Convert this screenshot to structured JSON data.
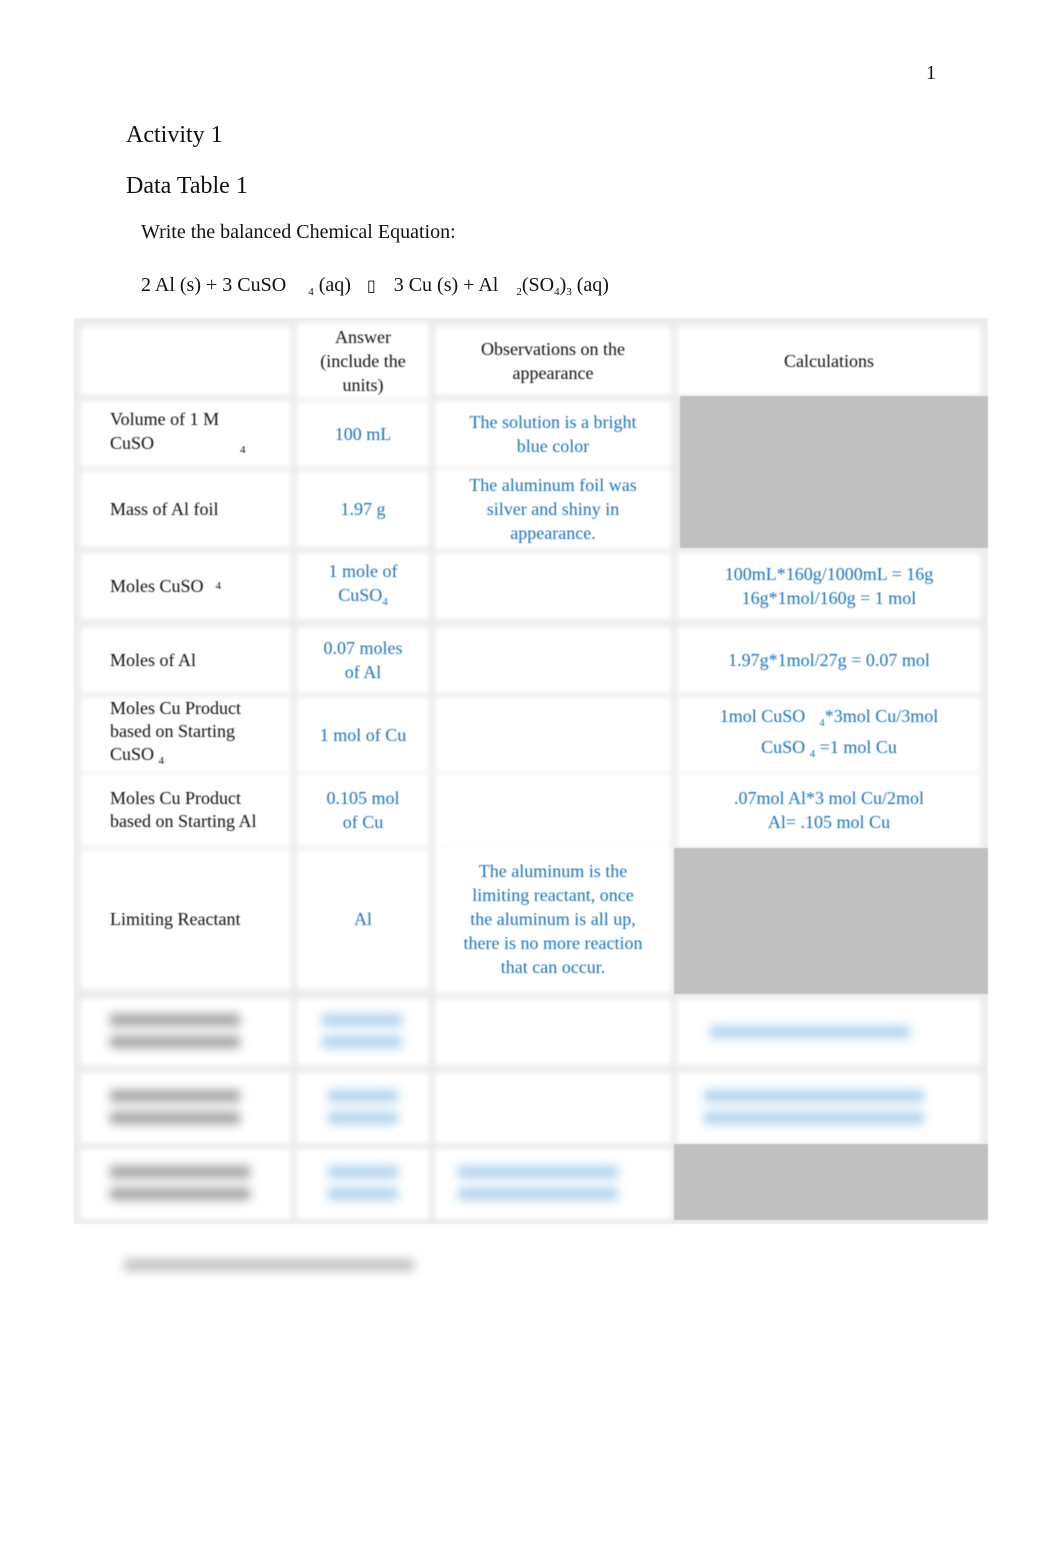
{
  "page_number": "1",
  "activity_title": "Activity 1",
  "table_title": "Data Table 1",
  "prompt": "Write the balanced Chemical Equation:",
  "equation": {
    "lhs_part1": "2 Al (s) + 3 CuSO",
    "lhs_sub": "4",
    "lhs_part2": " (aq)",
    "arrow": "▯",
    "rhs_part1": "3 Cu (s) + Al",
    "rhs_sub1": "2",
    "rhs_part2": "(SO",
    "rhs_sub2": "4",
    "rhs_part3": ")",
    "rhs_sub3": "3",
    "rhs_part4": " (aq)"
  },
  "table": {
    "headers": {
      "answer": "Answer (include the units)",
      "observations": "Observations on the appearance",
      "calculations": "Calculations"
    },
    "rows": [
      {
        "label": "Volume of 1 M CuSO",
        "label_sub": "4",
        "answer": "100 mL",
        "observation": "The solution is a bright blue color",
        "calculation": "",
        "calc_shaded": true
      },
      {
        "label": "Mass of Al foil",
        "label_sub": "",
        "answer": "1.97 g",
        "observation": "The aluminum foil was silver and shiny in appearance.",
        "calculation": "",
        "calc_shaded": true
      },
      {
        "label": "Moles CuSO",
        "label_sub": "4",
        "answer": "1 mole of CuSO",
        "answer_sub": "4",
        "observation": "",
        "calculation_line1": "100mL*160g/1000mL = 16g",
        "calculation_line2": "16g*1mol/160g = 1 mol",
        "calc_shaded": false
      },
      {
        "label": "Moles of Al",
        "label_sub": "",
        "answer": "0.07 moles of Al",
        "observation": "",
        "calculation": "1.97g*1mol/27g = 0.07 mol",
        "calc_shaded": false
      },
      {
        "label": "Moles Cu Product based on Starting CuSO",
        "label_sub": "4",
        "answer": "1 mol of Cu",
        "observation": "",
        "calculation_a": "1mol CuSO",
        "calculation_sub1": "4",
        "calculation_b": "*3mol Cu/3mol CuSO",
        "calculation_sub2": "4",
        "calculation_c": " =1 mol Cu",
        "calc_shaded": false
      },
      {
        "label": "Moles Cu Product based on Starting Al",
        "label_sub": "",
        "answer": "0.105 mol of Cu",
        "observation": "",
        "calculation": ".07mol Al*3 mol Cu/2mol Al= .105 mol Cu",
        "calc_shaded": false
      },
      {
        "label": "Limiting Reactant",
        "label_sub": "",
        "answer": "Al",
        "observation": "The aluminum is the limiting reactant, once the aluminum is all up, there is no more reaction that can occur.",
        "calculation": "",
        "calc_shaded": true
      }
    ],
    "blurred_rows_note": "3 additional rows obscured (blurred)"
  }
}
